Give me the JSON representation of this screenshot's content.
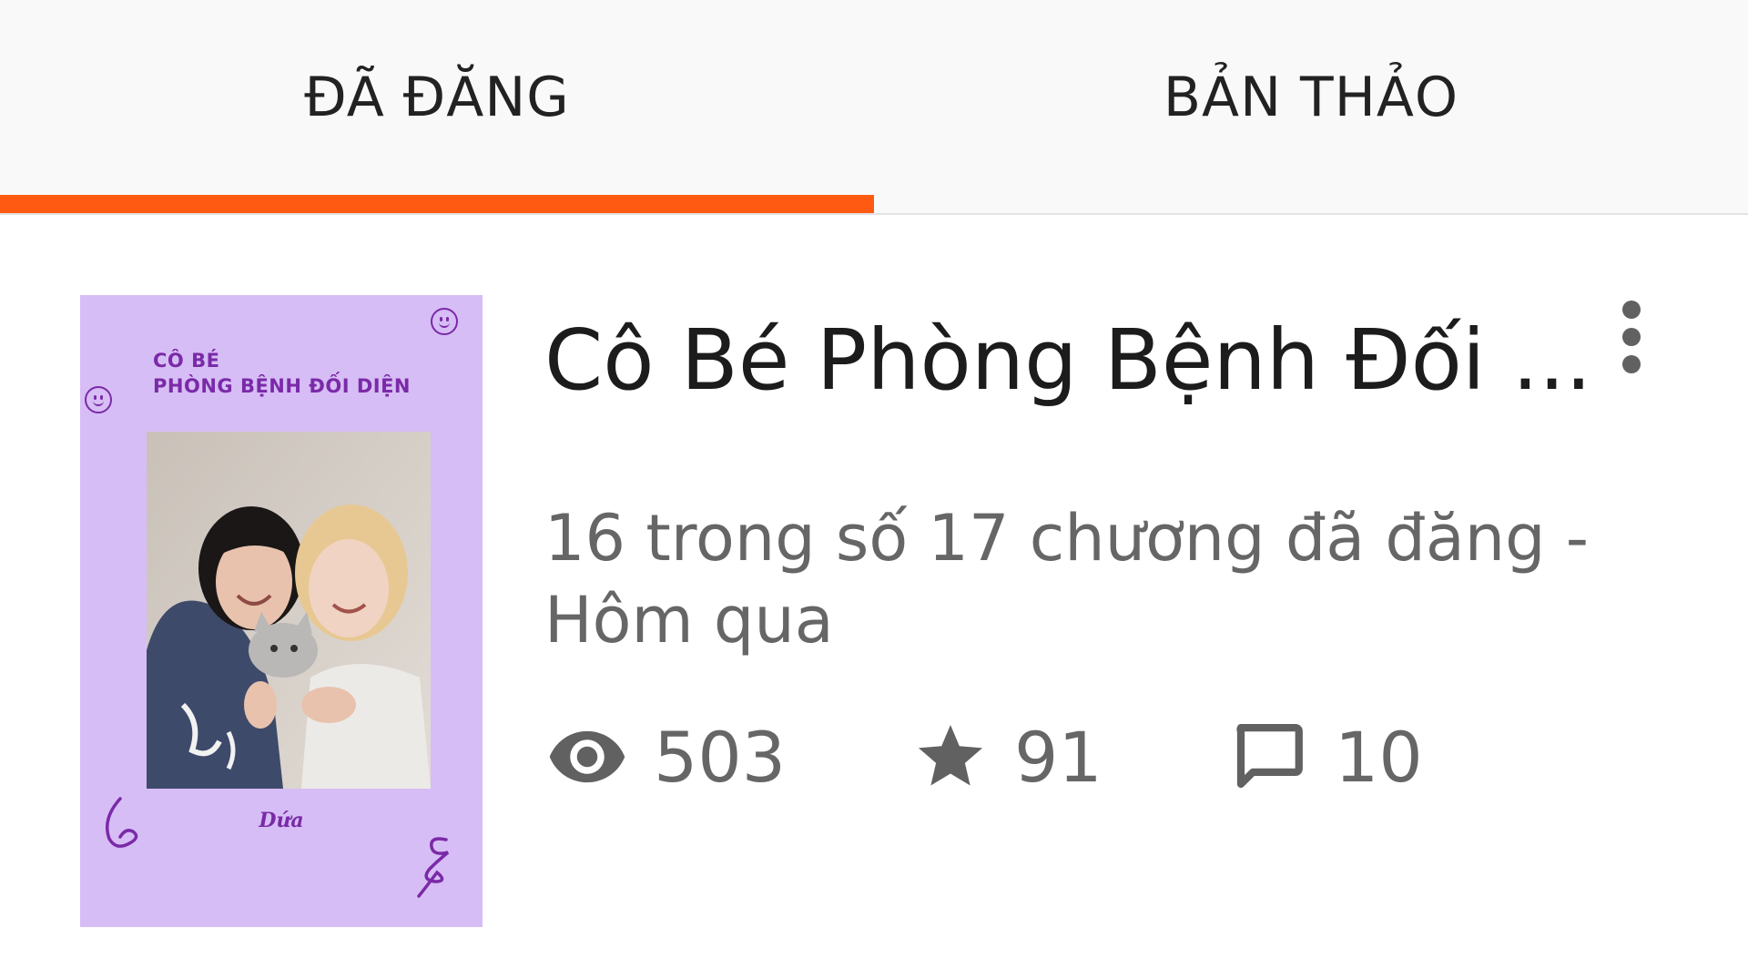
{
  "tabs": [
    {
      "label": "ĐÃ ĐĂNG",
      "active": true
    },
    {
      "label": "BẢN THẢO",
      "active": false
    }
  ],
  "colors": {
    "accent": "#ff5a12",
    "cover_background": "#d7bdf5",
    "cover_text": "#7a2aa8"
  },
  "story": {
    "title": "Cô Bé Phòng Bệnh Đối ...",
    "meta": "16 trong số 17 chương đã đăng - Hôm qua",
    "cover": {
      "title": "CÔ BÉ\nPHÒNG BỆNH ĐỐI DIỆN",
      "author": "Dứa"
    },
    "stats": {
      "reads": "503",
      "votes": "91",
      "comments": "10"
    }
  },
  "icons": {
    "more": "more-vertical-icon",
    "reads": "eye-icon",
    "votes": "star-icon",
    "comments": "comment-icon"
  }
}
